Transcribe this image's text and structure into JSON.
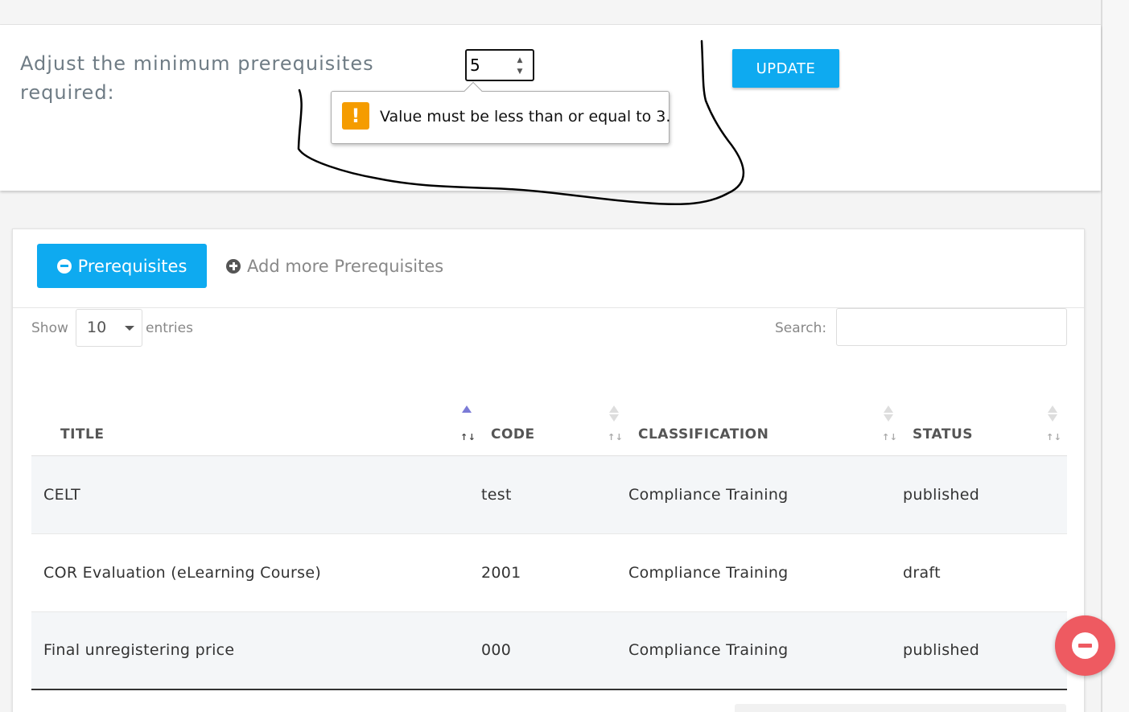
{
  "colors": {
    "accent": "#0eaaf0",
    "warning": "#f59c00",
    "fab": "#ee5a61",
    "sort_active": "#7b7bd6"
  },
  "settings": {
    "min_label": "Adjust the minimum prerequisites required:",
    "min_value": "5",
    "update_label": "UPDATE"
  },
  "validation": {
    "icon": "warning-exclamation-icon",
    "message": "Value must be less than or equal to 3."
  },
  "tabs": {
    "active_label": "Prerequisites",
    "active_icon": "minus-circle-icon",
    "inactive_label": "Add more Prerequisites",
    "inactive_icon": "plus-circle-icon"
  },
  "table_controls": {
    "show_label": "Show",
    "entries_value": "10",
    "entries_label": "entries",
    "search_label": "Search:",
    "search_value": ""
  },
  "table": {
    "headers": [
      "TITLE",
      "CODE",
      "CLASSIFICATION",
      "STATUS"
    ],
    "sorted_column": "TITLE",
    "sort_direction": "ascending",
    "rows": [
      [
        "CELT",
        "test",
        "Compliance Training",
        "published"
      ],
      [
        "COR Evaluation (eLearning Course)",
        "2001",
        "Compliance Training",
        "draft"
      ],
      [
        "Final unregistering price",
        "000",
        "Compliance Training",
        "published"
      ]
    ]
  },
  "fab": {
    "icon": "minus-circle-icon"
  }
}
